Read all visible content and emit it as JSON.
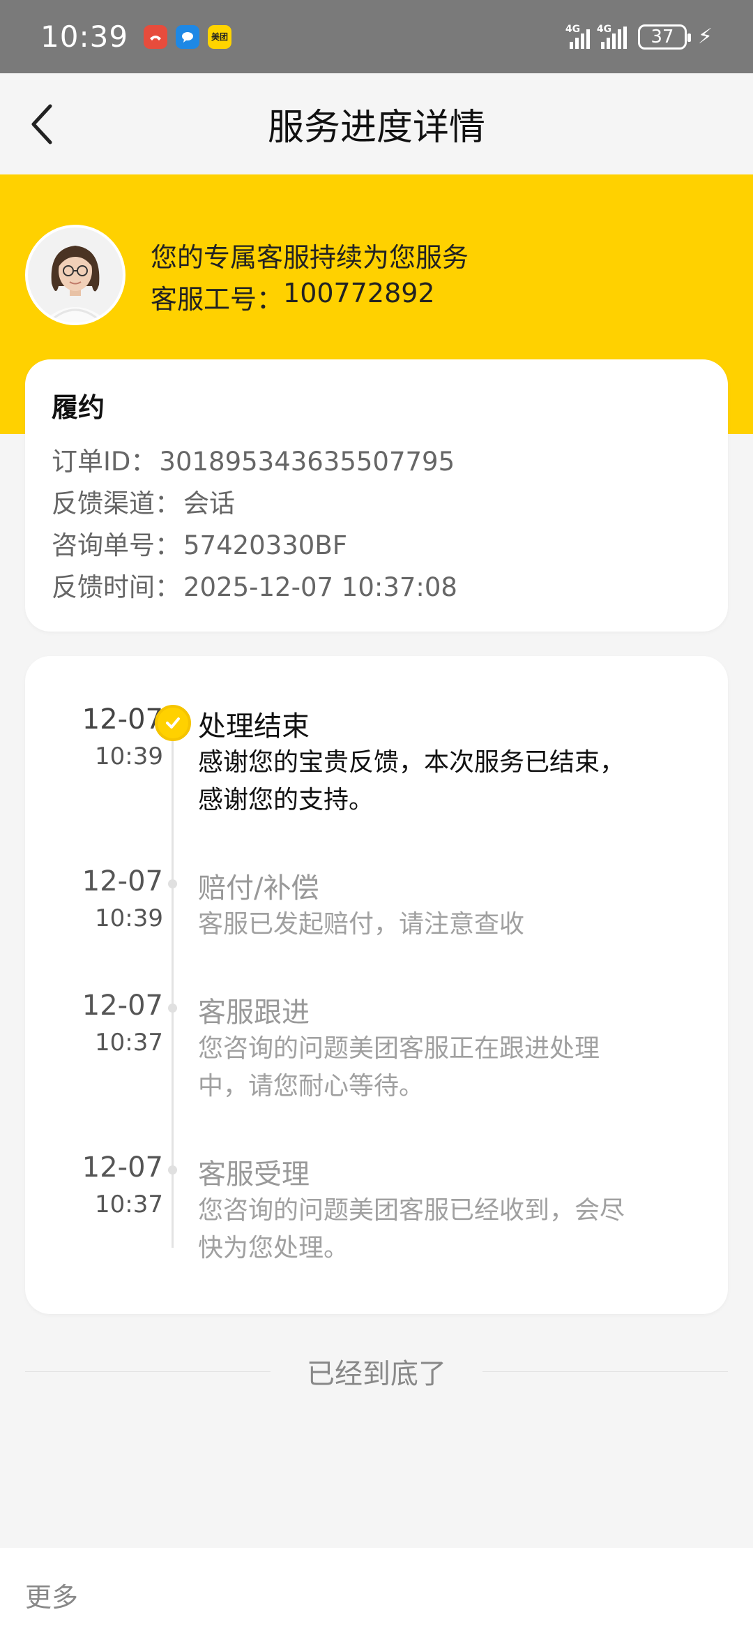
{
  "status_bar": {
    "time": "10:39",
    "app_icons": [
      {
        "icon": "missed-call-icon",
        "color": "#e74c3c"
      },
      {
        "icon": "message-bubble-icon",
        "color": "#1e88e5"
      },
      {
        "icon": "meituan-icon",
        "color": "#ffd400",
        "label": "美团"
      }
    ],
    "network1": "4G",
    "network2": "4G",
    "battery": "37"
  },
  "nav": {
    "title": "服务进度详情"
  },
  "agent": {
    "intro": "您的专属客服持续为您服务",
    "id_label": "客服工号：",
    "id_value": "100772892"
  },
  "info_card": {
    "title": "履约",
    "rows": [
      {
        "key": "订单ID：",
        "value": "301895343635507795"
      },
      {
        "key": "反馈渠道：",
        "value": "会话"
      },
      {
        "key": "咨询单号：",
        "value": "57420330BF"
      },
      {
        "key": "反馈时间：",
        "value": "2025-12-07 10:37:08"
      }
    ]
  },
  "timeline": [
    {
      "date": "12-07",
      "time": "10:39",
      "title": "处理结束",
      "desc_lines": [
        "感谢您的宝贵反馈，本次服务已结束，",
        "感谢您的支持。"
      ],
      "active": true
    },
    {
      "date": "12-07",
      "time": "10:39",
      "title": "赔付/补偿",
      "desc_lines": [
        "客服已发起赔付，请注意查收"
      ],
      "active": false
    },
    {
      "date": "12-07",
      "time": "10:37",
      "title": "客服跟进",
      "desc_lines": [
        "您咨询的问题美团客服正在跟进处理",
        "中，请您耐心等待。"
      ],
      "active": false
    },
    {
      "date": "12-07",
      "time": "10:37",
      "title": "客服受理",
      "desc_lines": [
        "您咨询的问题美团客服已经收到，会尽",
        "快为您处理。"
      ],
      "active": false
    }
  ],
  "end_text": "已经到底了",
  "footer": {
    "more": "更多"
  },
  "colors": {
    "brand_yellow": "#ffd100",
    "status_bar": "#7a7a7a",
    "background": "#f5f5f5"
  }
}
